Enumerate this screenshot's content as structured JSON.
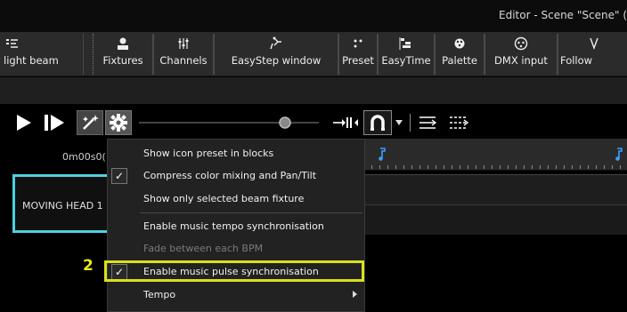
{
  "window": {
    "title": "Editor - Scene \"Scene\" ("
  },
  "ribbon": {
    "items": [
      {
        "label": "light beam",
        "icon": "light-beam-icon"
      },
      {
        "label": "Fixtures",
        "icon": "fixtures-icon"
      },
      {
        "label": "Channels",
        "icon": "channels-icon"
      },
      {
        "label": "EasyStep window",
        "icon": "easystep-icon"
      },
      {
        "label": "Preset",
        "icon": "preset-icon"
      },
      {
        "label": "EasyTime",
        "icon": "easytime-icon"
      },
      {
        "label": "Palette",
        "icon": "palette-icon"
      },
      {
        "label": "DMX input",
        "icon": "dmx-input-icon"
      },
      {
        "label": "Follow",
        "icon": "follow-icon"
      }
    ]
  },
  "timeline": {
    "timecode": "0m00s0("
  },
  "track": {
    "label": "MOVING HEAD 1"
  },
  "menu": {
    "items": [
      {
        "label": "Show icon preset in blocks",
        "checked": false,
        "disabled": false
      },
      {
        "label": "Compress color mixing and Pan/Tilt",
        "checked": true,
        "disabled": false
      },
      {
        "label": "Show only selected beam fixture",
        "checked": false,
        "disabled": false
      },
      {
        "label": "Enable music tempo synchronisation",
        "checked": false,
        "disabled": false
      },
      {
        "label": "Fade between each BPM",
        "checked": false,
        "disabled": true
      },
      {
        "label": "Enable music pulse synchronisation",
        "checked": true,
        "disabled": false
      },
      {
        "label": "Tempo",
        "checked": false,
        "disabled": false,
        "submenu": true
      }
    ]
  },
  "annotation": {
    "step_number": "2",
    "highlight_color": "#d9e21a"
  },
  "colors": {
    "selection_cyan": "#4fd0e0",
    "beat_marker": "#3aa0ff"
  }
}
